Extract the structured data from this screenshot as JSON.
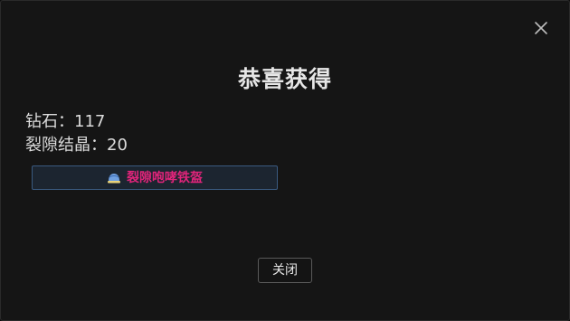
{
  "dialog": {
    "title": "恭喜获得",
    "rewards": [
      {
        "text": "钻石：117"
      },
      {
        "text": "裂隙结晶：20"
      }
    ],
    "item": {
      "name": "裂隙咆哮铁盔",
      "icon": "helmet-icon",
      "name_color": "#e0247a"
    },
    "close_button_label": "关闭",
    "close_icon": "close-icon"
  }
}
